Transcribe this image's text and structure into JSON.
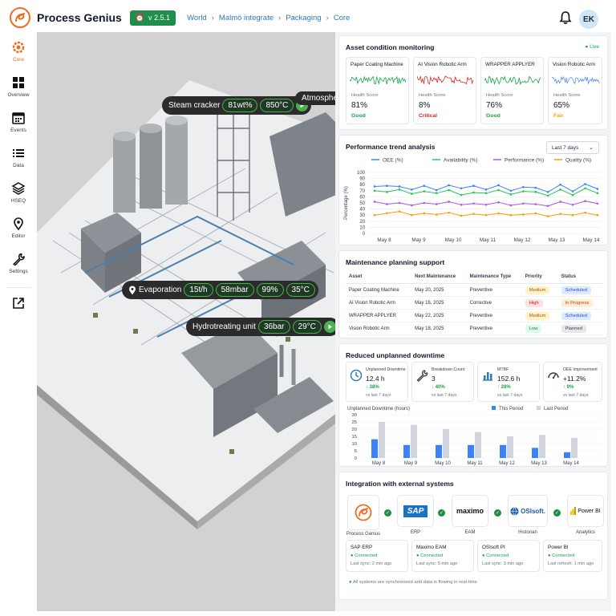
{
  "header": {
    "brand": "Process Genius",
    "version": "v 2.5.1",
    "breadcrumb": [
      "World",
      "Malmö integrate",
      "Packaging",
      "Core"
    ],
    "avatar": "EK"
  },
  "sidebar": {
    "items": [
      {
        "label": "Core",
        "icon": "core-logo-icon",
        "active": true
      },
      {
        "label": "Overview",
        "icon": "grid-icon"
      },
      {
        "label": "Events",
        "icon": "calendar-icon"
      },
      {
        "label": "Data",
        "icon": "list-icon"
      },
      {
        "label": "HSEQ",
        "icon": "layers-icon"
      },
      {
        "label": "Editor",
        "icon": "map-pin-icon"
      },
      {
        "label": "Settings",
        "icon": "wrench-icon"
      },
      {
        "label": "",
        "icon": "external-link-icon"
      }
    ]
  },
  "callouts": [
    {
      "name": "Steam cracker",
      "values": [
        "81wt%",
        "850°C"
      ],
      "play": true
    },
    {
      "name": "Atmosphe",
      "values": [],
      "play": false
    },
    {
      "name": "Evaporation",
      "values": [
        "15t/h",
        "58mbar",
        "99%",
        "35°C"
      ],
      "play": false
    },
    {
      "name": "Hydrotreating unit",
      "values": [
        "36bar",
        "29°C"
      ],
      "play": true
    }
  ],
  "asset_monitoring": {
    "title": "Asset condition monitoring",
    "live": "Live",
    "health_label": "Health Score",
    "assets": [
      {
        "name": "Paper Coating Machine",
        "score": "81%",
        "status": "Good",
        "color": "#16a34a"
      },
      {
        "name": "AI Vision Robotic Arm",
        "score": "8%",
        "status": "Critical",
        "color": "#dc2626"
      },
      {
        "name": "WRAPPER APPLYER",
        "score": "76%",
        "status": "Good",
        "color": "#16a34a"
      },
      {
        "name": "Vision Robotic Arm",
        "score": "65%",
        "status": "Fair",
        "color": "#f59e0b"
      }
    ]
  },
  "performance": {
    "title": "Performance trend analysis",
    "range": "Last 7 days"
  },
  "chart_data": [
    {
      "type": "line",
      "x": [
        "May 8",
        "May 9",
        "May 10",
        "May 11",
        "May 12",
        "May 13",
        "May 14"
      ],
      "ylabel": "Percentage (%)",
      "ylim": [
        0,
        100
      ],
      "yticks": [
        0,
        10,
        20,
        30,
        40,
        50,
        60,
        70,
        80,
        90,
        100
      ],
      "legend": "top",
      "series": [
        {
          "name": "OEE (%)",
          "color": "#3b82f6",
          "values": [
            77,
            78,
            77,
            72,
            78,
            71,
            79,
            74,
            78,
            72,
            79,
            70,
            76,
            75,
            68,
            80,
            69,
            81,
            73
          ]
        },
        {
          "name": "Availability (%)",
          "color": "#22c55e",
          "values": [
            70,
            68,
            72,
            65,
            69,
            66,
            71,
            63,
            67,
            66,
            71,
            64,
            69,
            68,
            62,
            72,
            63,
            74,
            66
          ]
        },
        {
          "name": "Performance (%)",
          "color": "#a855f7",
          "values": [
            52,
            48,
            50,
            46,
            50,
            48,
            52,
            47,
            49,
            47,
            51,
            46,
            49,
            48,
            45,
            52,
            47,
            53,
            49
          ]
        },
        {
          "name": "Quality (%)",
          "color": "#f59e0b",
          "values": [
            30,
            33,
            36,
            30,
            33,
            31,
            34,
            29,
            32,
            30,
            33,
            30,
            31,
            33,
            28,
            32,
            30,
            34,
            30
          ]
        }
      ]
    },
    {
      "type": "bar",
      "categories": [
        "May 8",
        "May 9",
        "May 10",
        "May 11",
        "May 12",
        "May 13",
        "May 14"
      ],
      "title": "Unplanned Downtime (hours)",
      "ylim": [
        0,
        30
      ],
      "yticks": [
        0,
        5,
        10,
        15,
        20,
        25,
        30
      ],
      "legend": "top-right",
      "series": [
        {
          "name": "This Period",
          "color": "#3b82f6",
          "values": [
            13,
            9,
            9,
            9,
            9,
            7,
            4
          ]
        },
        {
          "name": "Last Period",
          "color": "#d1d5db",
          "values": [
            25,
            23,
            20,
            18,
            15,
            16,
            14
          ]
        }
      ]
    }
  ],
  "maintenance": {
    "title": "Maintenance planning support",
    "columns": [
      "Asset",
      "Next Maintenance",
      "Maintenance Type",
      "Priority",
      "Status"
    ],
    "rows": [
      {
        "asset": "Paper Coating Machine",
        "next": "May 20, 2025",
        "type": "Preventive",
        "priority": "Medium",
        "status": "Scheduled"
      },
      {
        "asset": "AI Vision Robotic Arm",
        "next": "May 16, 2025",
        "type": "Corrective",
        "priority": "High",
        "status": "In Progress"
      },
      {
        "asset": "WRAPPER APPLYER",
        "next": "May 22, 2025",
        "type": "Preventive",
        "priority": "Medium",
        "status": "Scheduled"
      },
      {
        "asset": "Vision Robotic Arm",
        "next": "May 18, 2025",
        "type": "Preventive",
        "priority": "Low",
        "status": "Planned"
      }
    ]
  },
  "downtime": {
    "title": "Reduced unplanned downtime",
    "kpis": [
      {
        "label": "Unplanned Downtime",
        "value": "12.4 h",
        "change": "↓ 38%",
        "vs": "vs last 7 days",
        "icon": "clock-icon"
      },
      {
        "label": "Breakdown Count",
        "value": "3",
        "change": "↓ 40%",
        "vs": "vs last 7 days",
        "icon": "wrench-icon"
      },
      {
        "label": "MTBF",
        "value": "152.6 h",
        "change": "↑ 28%",
        "vs": "vs last 7 days",
        "icon": "bar-chart-icon"
      },
      {
        "label": "OEE Improvement",
        "value": "+11.2%",
        "change": "↑ 9%",
        "vs": "vs last 7 days",
        "icon": "gauge-icon"
      }
    ]
  },
  "integration": {
    "title": "Integration with external systems",
    "systems": [
      {
        "label": "Process Genius",
        "logo": ""
      },
      {
        "label": "ERP",
        "logo": "SAP"
      },
      {
        "label": "EAM",
        "logo": "maximo"
      },
      {
        "label": "Historian",
        "logo": "OSIsoft."
      },
      {
        "label": "Analytics",
        "logo": "Power BI"
      }
    ],
    "connections": [
      {
        "name": "SAP ERP",
        "status": "Connected",
        "sync": "Last sync: 2 min ago"
      },
      {
        "name": "Maximo EAM",
        "status": "Connected",
        "sync": "Last sync: 5 min ago"
      },
      {
        "name": "OSIsoft PI",
        "status": "Connected",
        "sync": "Last sync: 3 min ago"
      },
      {
        "name": "Power BI",
        "status": "Connected",
        "sync": "Last refresh: 1 min ago"
      }
    ],
    "footnote": "All systems are synchronized and data is flowing in real-time."
  }
}
